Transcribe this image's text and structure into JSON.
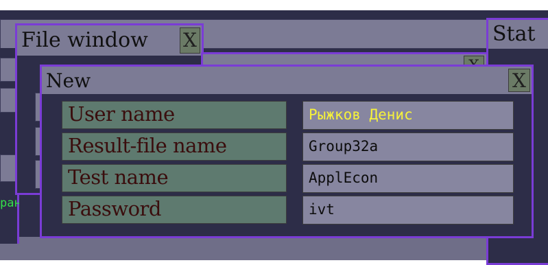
{
  "file_window": {
    "title": "File window",
    "close_label": "X"
  },
  "stat_window": {
    "title_partial": "Stat"
  },
  "back_window": {
    "close_label": "X"
  },
  "left_fragments": {
    "green_text_partial": "ранц"
  },
  "new_dialog": {
    "title": "New",
    "close_label": "X",
    "fields": [
      {
        "label": "User name",
        "value": "Рыжков Денис"
      },
      {
        "label": "Result-file name",
        "value": "Group32a"
      },
      {
        "label": "Test name",
        "value": "ApplEcon"
      },
      {
        "label": "Password",
        "value": "ivt"
      }
    ]
  },
  "colors": {
    "desktop": "#2d2d48",
    "panel_grey": "#7c7b95",
    "frame_purple": "#7a3cd6",
    "label_green": "#5e7a6f",
    "value_grey": "#8786a0",
    "highlight_yellow": "#f6f23a",
    "label_text": "#3a0d0d"
  }
}
